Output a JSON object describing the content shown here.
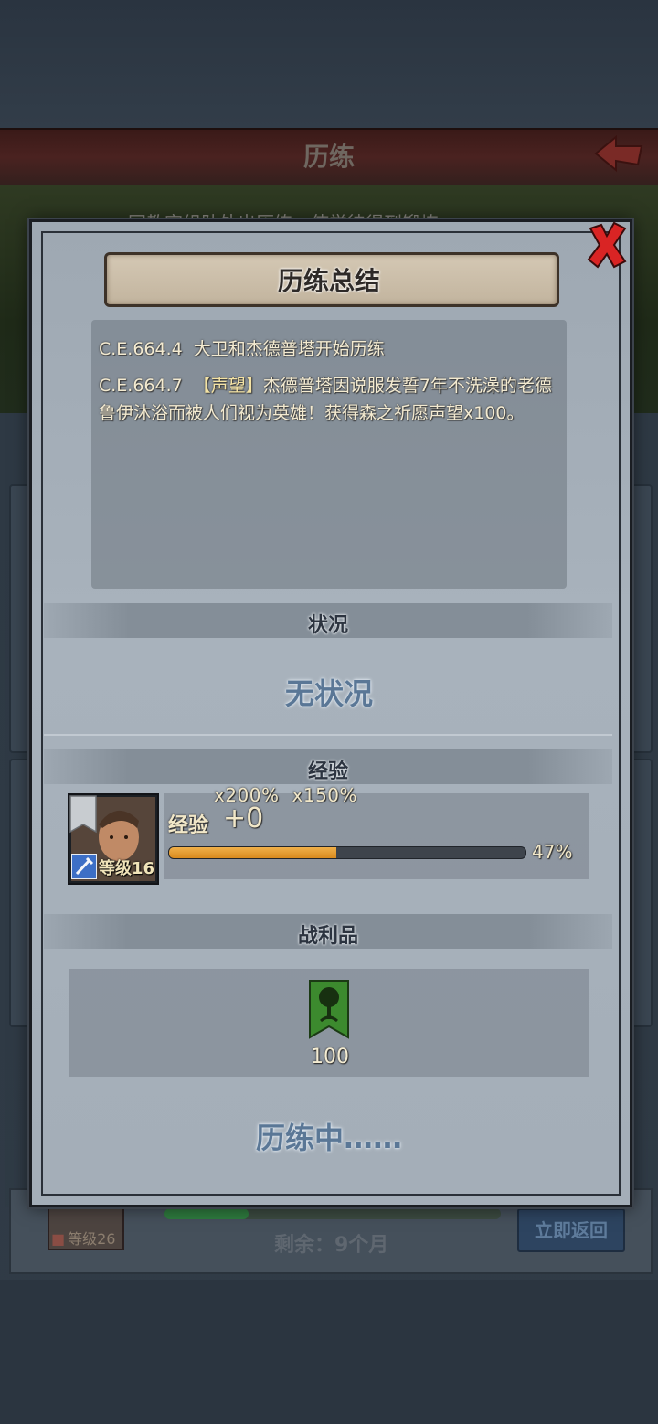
{
  "background": {
    "header_title": "历练",
    "subtitle": "同教宗组队外出历练，使学徒得到锻炼",
    "party_level": "等级26",
    "remaining": "剩余：9个月",
    "return_button": "立即返回",
    "progress": 0.25
  },
  "modal": {
    "title": "历练总结",
    "log": [
      {
        "date": "C.E.664.4",
        "text": "大卫和杰德普塔开始历练"
      },
      {
        "date": "C.E.664.7",
        "tag": "【声望】",
        "text": "杰德普塔因说服发誓7年不洗澡的老德鲁伊沐浴而被人们视为英雄！获得森之祈愿声望x100。"
      }
    ],
    "status_section": {
      "label": "状况",
      "value": "无状况"
    },
    "exp_section": {
      "label": "经验",
      "multipliers": [
        "x200%",
        "x150%"
      ],
      "exp_label": "经验",
      "exp_gain": "+0",
      "progress_pct": 47,
      "progress_text": "47%",
      "character_level": "等级16"
    },
    "loot_section": {
      "label": "战利品",
      "items": [
        {
          "icon": "forest-banner-icon",
          "count": "100"
        }
      ]
    },
    "footer_status": "历练中……"
  },
  "colors": {
    "accent_orange": "#e09a30",
    "status_blue": "#5a7796",
    "close_red": "#d92424",
    "banner_green": "#3c8a2e"
  }
}
